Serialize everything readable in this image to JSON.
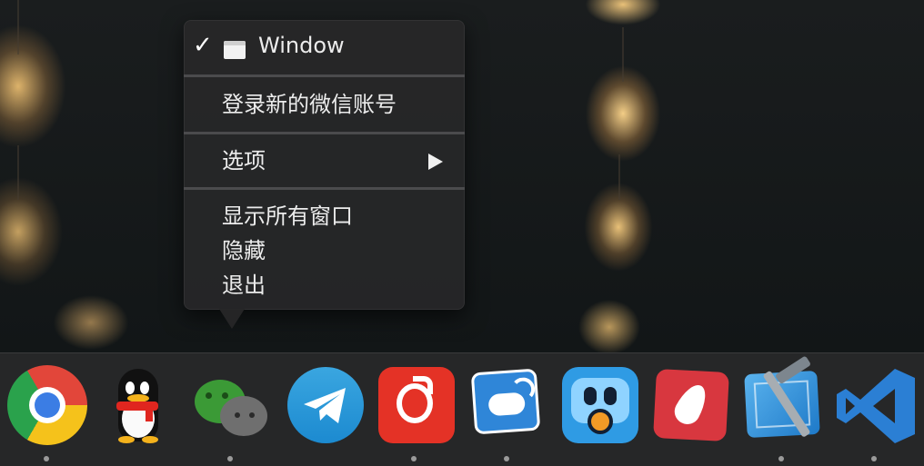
{
  "menu": {
    "window_item": {
      "checked": true,
      "label": "Window",
      "icon": "window-icon"
    },
    "login_new_account": "登录新的微信账号",
    "options": {
      "label": "选项",
      "has_submenu": true
    },
    "show_all_windows": "显示所有窗口",
    "hide": "隐藏",
    "quit": "退出"
  },
  "dock": {
    "items": [
      {
        "name": "chrome",
        "icon": "chrome-icon",
        "running": true
      },
      {
        "name": "qq",
        "icon": "qq-penguin-icon",
        "running": false
      },
      {
        "name": "wechat",
        "icon": "wechat-icon",
        "running": true
      },
      {
        "name": "telegram",
        "icon": "telegram-icon",
        "running": false
      },
      {
        "name": "netease-music",
        "icon": "netease-music-icon",
        "running": true
      },
      {
        "name": "chat-app",
        "icon": "blue-chat-icon",
        "running": true
      },
      {
        "name": "tweetbot",
        "icon": "tweetbot-icon",
        "running": false
      },
      {
        "name": "red-leaf-app",
        "icon": "red-leaf-icon",
        "running": false
      },
      {
        "name": "xcode",
        "icon": "xcode-icon",
        "running": true
      },
      {
        "name": "vscode",
        "icon": "vscode-icon",
        "running": true
      }
    ]
  },
  "colors": {
    "menu_bg": "#262628",
    "dock_bg": "#262728",
    "chrome_red": "#e2463a",
    "telegram_blue": "#2aa0dd",
    "netease_red": "#e43226",
    "vscode_blue": "#2b7fd4"
  }
}
